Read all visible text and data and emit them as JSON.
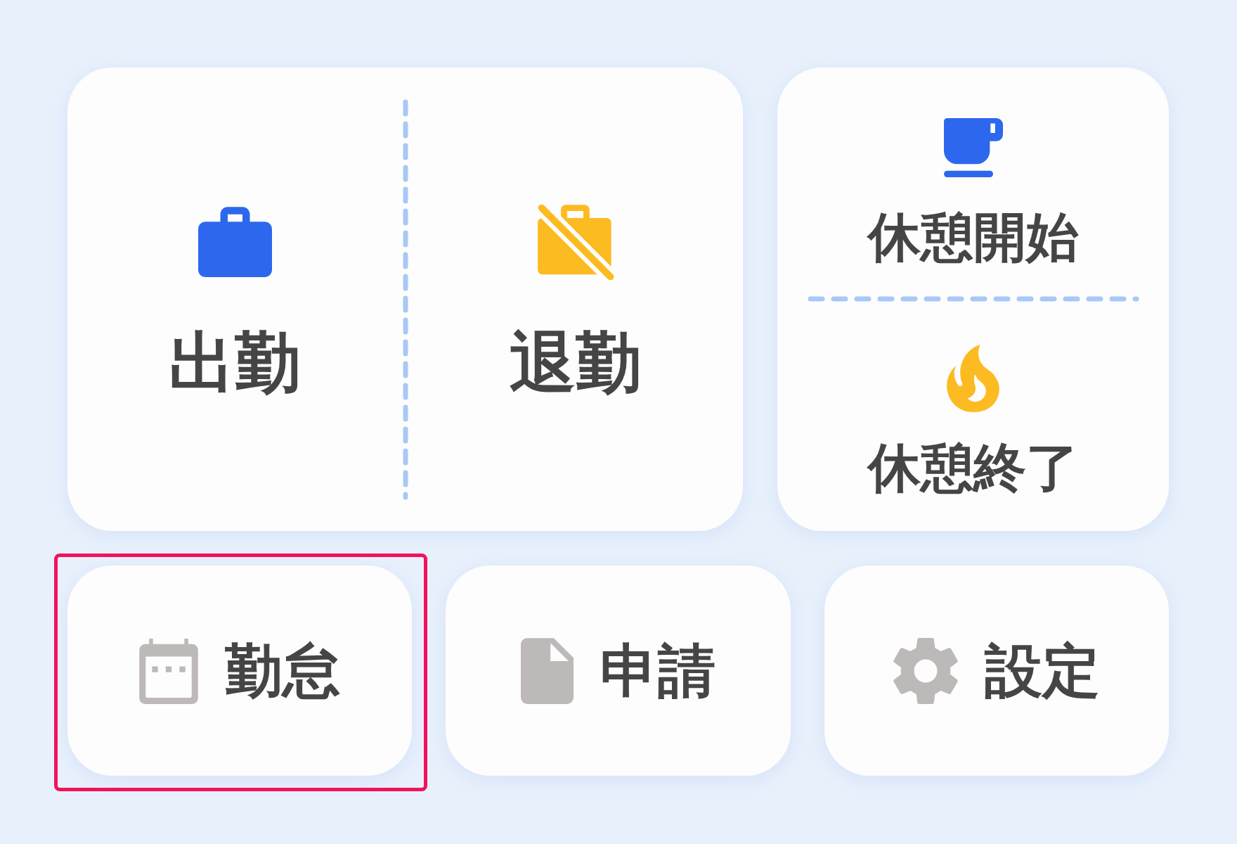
{
  "work_panel": {
    "buttons": [
      {
        "kind": "start",
        "label": "出勤"
      },
      {
        "kind": "end",
        "label": "退勤"
      }
    ]
  },
  "break_panel": {
    "buttons": [
      {
        "kind": "start",
        "label": "休憩開始"
      },
      {
        "kind": "end",
        "label": "休憩終了"
      }
    ]
  },
  "menu": [
    {
      "kind": "attendance",
      "label": "勤怠",
      "selected": true
    },
    {
      "kind": "request",
      "label": "申請",
      "selected": false
    },
    {
      "kind": "settings",
      "label": "設定",
      "selected": false
    }
  ]
}
